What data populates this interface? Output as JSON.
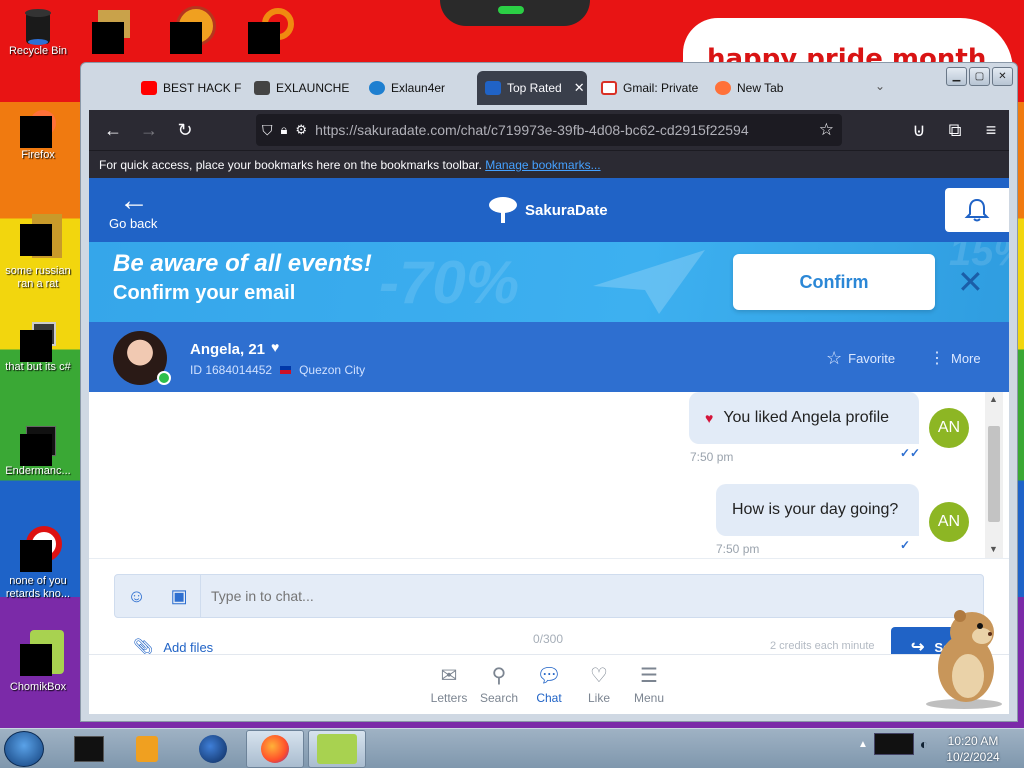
{
  "desktop": {
    "banner_text": "happy pride month",
    "icons": [
      {
        "label": "Recycle Bin",
        "icon": "recycle-bin-icon"
      },
      {
        "label": "Firefox",
        "icon": "firefox-icon"
      },
      {
        "label": "some russian ran a rat",
        "icon": "app-icon"
      },
      {
        "label": "that but its c#",
        "icon": "windows-icon"
      },
      {
        "label": "Endermanc...",
        "icon": "terminal-icon"
      },
      {
        "label": "none of you retards kno...",
        "icon": "opera-icon"
      },
      {
        "label": "ChomikBox",
        "icon": "chomikbox-icon"
      }
    ]
  },
  "browser": {
    "tabs": [
      {
        "label": "BEST HACK F",
        "icon": "youtube-icon",
        "color": "#ff0000"
      },
      {
        "label": "EXLAUNCHE",
        "icon": "exlauncher-icon",
        "color": "#444444"
      },
      {
        "label": "Exlaun4er",
        "icon": "exlaun4er-icon",
        "color": "#1e7fd0"
      },
      {
        "label": "Top Rated",
        "icon": "sakuradate-icon",
        "color": "#2063c6",
        "active": true
      },
      {
        "label": "Gmail: Private",
        "icon": "gmail-icon",
        "color": "#d93025"
      },
      {
        "label": "New Tab",
        "icon": "firefox-icon",
        "color": "#ff7139"
      }
    ],
    "url_host": "https://sakuradate.com",
    "url_path": "/chat/c719973e-39fb-4d08-bc62-cd2915f22594",
    "bookmarks_text": "For quick access, place your bookmarks here on the bookmarks toolbar.",
    "bookmarks_link": "Manage bookmarks..."
  },
  "site": {
    "go_back": "Go back",
    "logo_text": "SakuraDate",
    "banner": {
      "line1": "Be aware of all events!",
      "line2": "Confirm your email",
      "bg1": "-70%",
      "bg2": "15%",
      "confirm": "Confirm",
      "close": "✕"
    },
    "profile": {
      "name": "Angela, 21",
      "id": "ID 1684014452",
      "city": "Quezon City",
      "favorite": "Favorite",
      "more": "More"
    },
    "messages": [
      {
        "text": "You liked Angela profile",
        "time": "7:50 pm",
        "avatar": "AN",
        "liked": true
      },
      {
        "text": "How is your day going?",
        "time": "7:50 pm",
        "avatar": "AN",
        "liked": false
      }
    ],
    "composer": {
      "placeholder": "Type in to chat...",
      "counter": "0/300",
      "add_files": "Add files",
      "credits": "2 credits each minute",
      "send": "Se"
    },
    "nav": [
      {
        "label": "Letters",
        "icon": "envelope-icon"
      },
      {
        "label": "Search",
        "icon": "search-icon"
      },
      {
        "label": "Chat",
        "icon": "chat-icon",
        "active": true
      },
      {
        "label": "Like",
        "icon": "heart-icon"
      },
      {
        "label": "Menu",
        "icon": "menu-icon"
      }
    ]
  },
  "taskbar": {
    "time": "10:20 AM",
    "date": "10/2/2024",
    "pinned": [
      "terminal-icon",
      "media-player-icon",
      "globe-icon",
      "firefox-icon",
      "chomikbox-icon"
    ]
  }
}
